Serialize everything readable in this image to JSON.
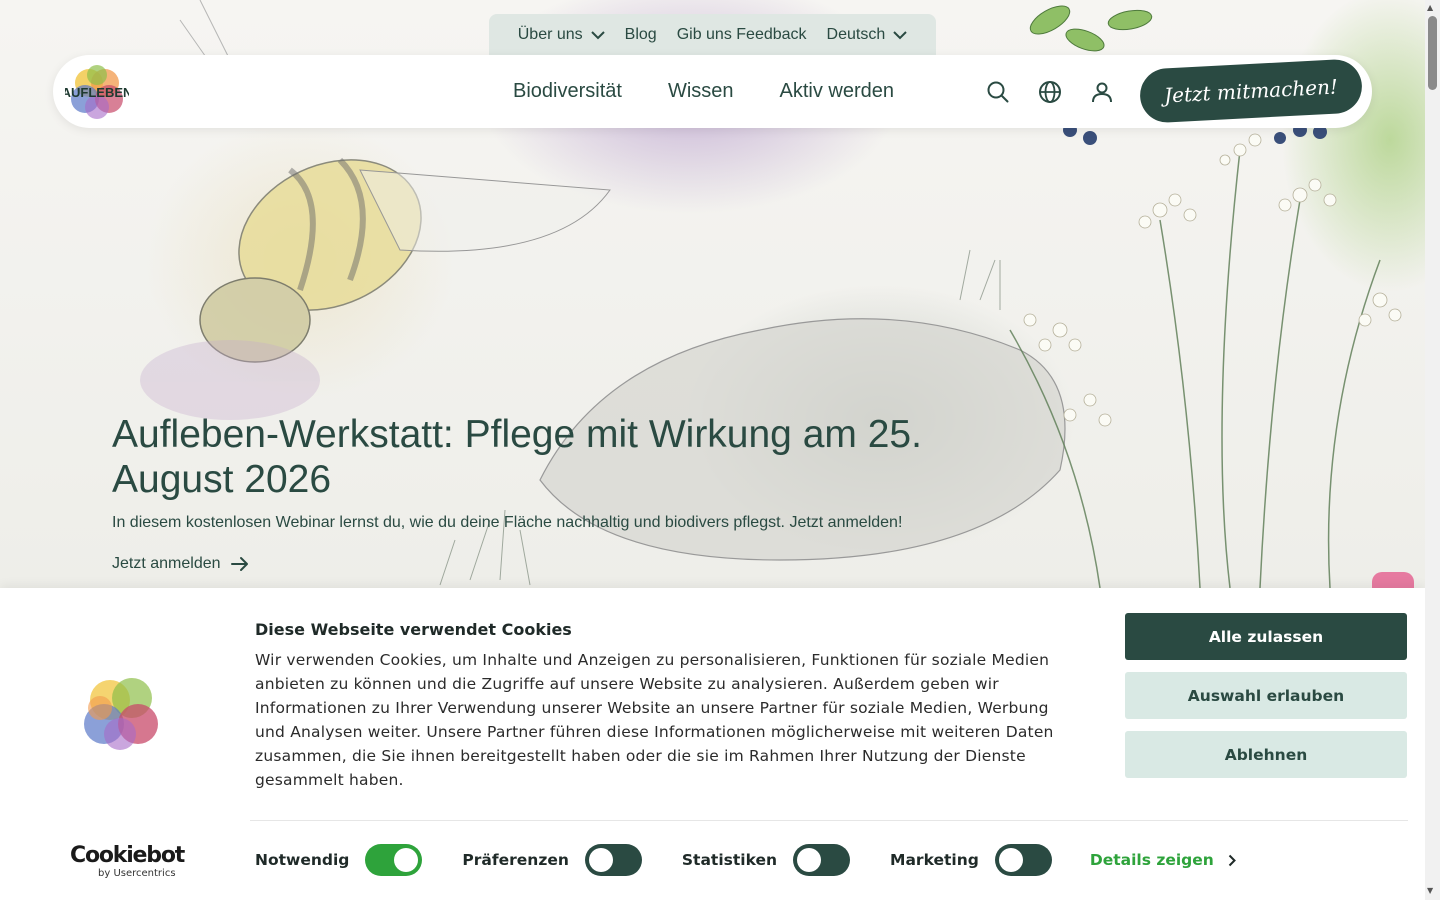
{
  "topnav": {
    "items": [
      {
        "label": "Über uns",
        "has_dropdown": true
      },
      {
        "label": "Blog",
        "has_dropdown": false
      },
      {
        "label": "Gib uns Feedback",
        "has_dropdown": false
      },
      {
        "label": "Deutsch",
        "has_dropdown": true
      }
    ]
  },
  "mainnav": {
    "logo_text": "AUFLEBEN",
    "links": [
      "Biodiversität",
      "Wissen",
      "Aktiv werden"
    ],
    "icons": [
      "search-icon",
      "globe-icon",
      "user-icon"
    ],
    "cta_label": "Jetzt mitmachen!"
  },
  "hero": {
    "title": "Aufleben-Werkstatt: Pflege mit Wirkung am 25. August 2026",
    "text": "In diesem kostenlosen Webinar lernst du, wie du deine Fläche nachhaltig und biodivers pflegst. Jetzt anmelden!",
    "link_label": "Jetzt anmelden"
  },
  "cookie_banner": {
    "title": "Diese Webseite verwendet Cookies",
    "text": "Wir verwenden Cookies, um Inhalte und Anzeigen zu personalisieren, Funktionen für soziale Medien anbieten zu können und die Zugriffe auf unsere Website zu analysieren. Außerdem geben wir Informationen zu Ihrer Verwendung unserer Website an unsere Partner für soziale Medien, Werbung und Analysen weiter. Unsere Partner führen diese Informationen möglicherweise mit weiteren Daten zusammen, die Sie ihnen bereitgestellt haben oder die sie im Rahmen Ihrer Nutzung der Dienste gesammelt haben.",
    "buttons": {
      "accept_all": "Alle zulassen",
      "allow_selection": "Auswahl erlauben",
      "reject": "Ablehnen"
    },
    "brand": {
      "name": "Cookiebot",
      "sub": "by Usercentrics"
    },
    "consents": [
      {
        "label": "Notwendig",
        "enabled": true
      },
      {
        "label": "Präferenzen",
        "enabled": false
      },
      {
        "label": "Statistiken",
        "enabled": false
      },
      {
        "label": "Marketing",
        "enabled": false
      }
    ],
    "details_label": "Details zeigen"
  },
  "colors": {
    "brand_dark": "#2a4a42",
    "toggle_on": "#2ea33b",
    "button_light": "#d9e9e4",
    "topnav_bg": "#dfe7e3"
  }
}
